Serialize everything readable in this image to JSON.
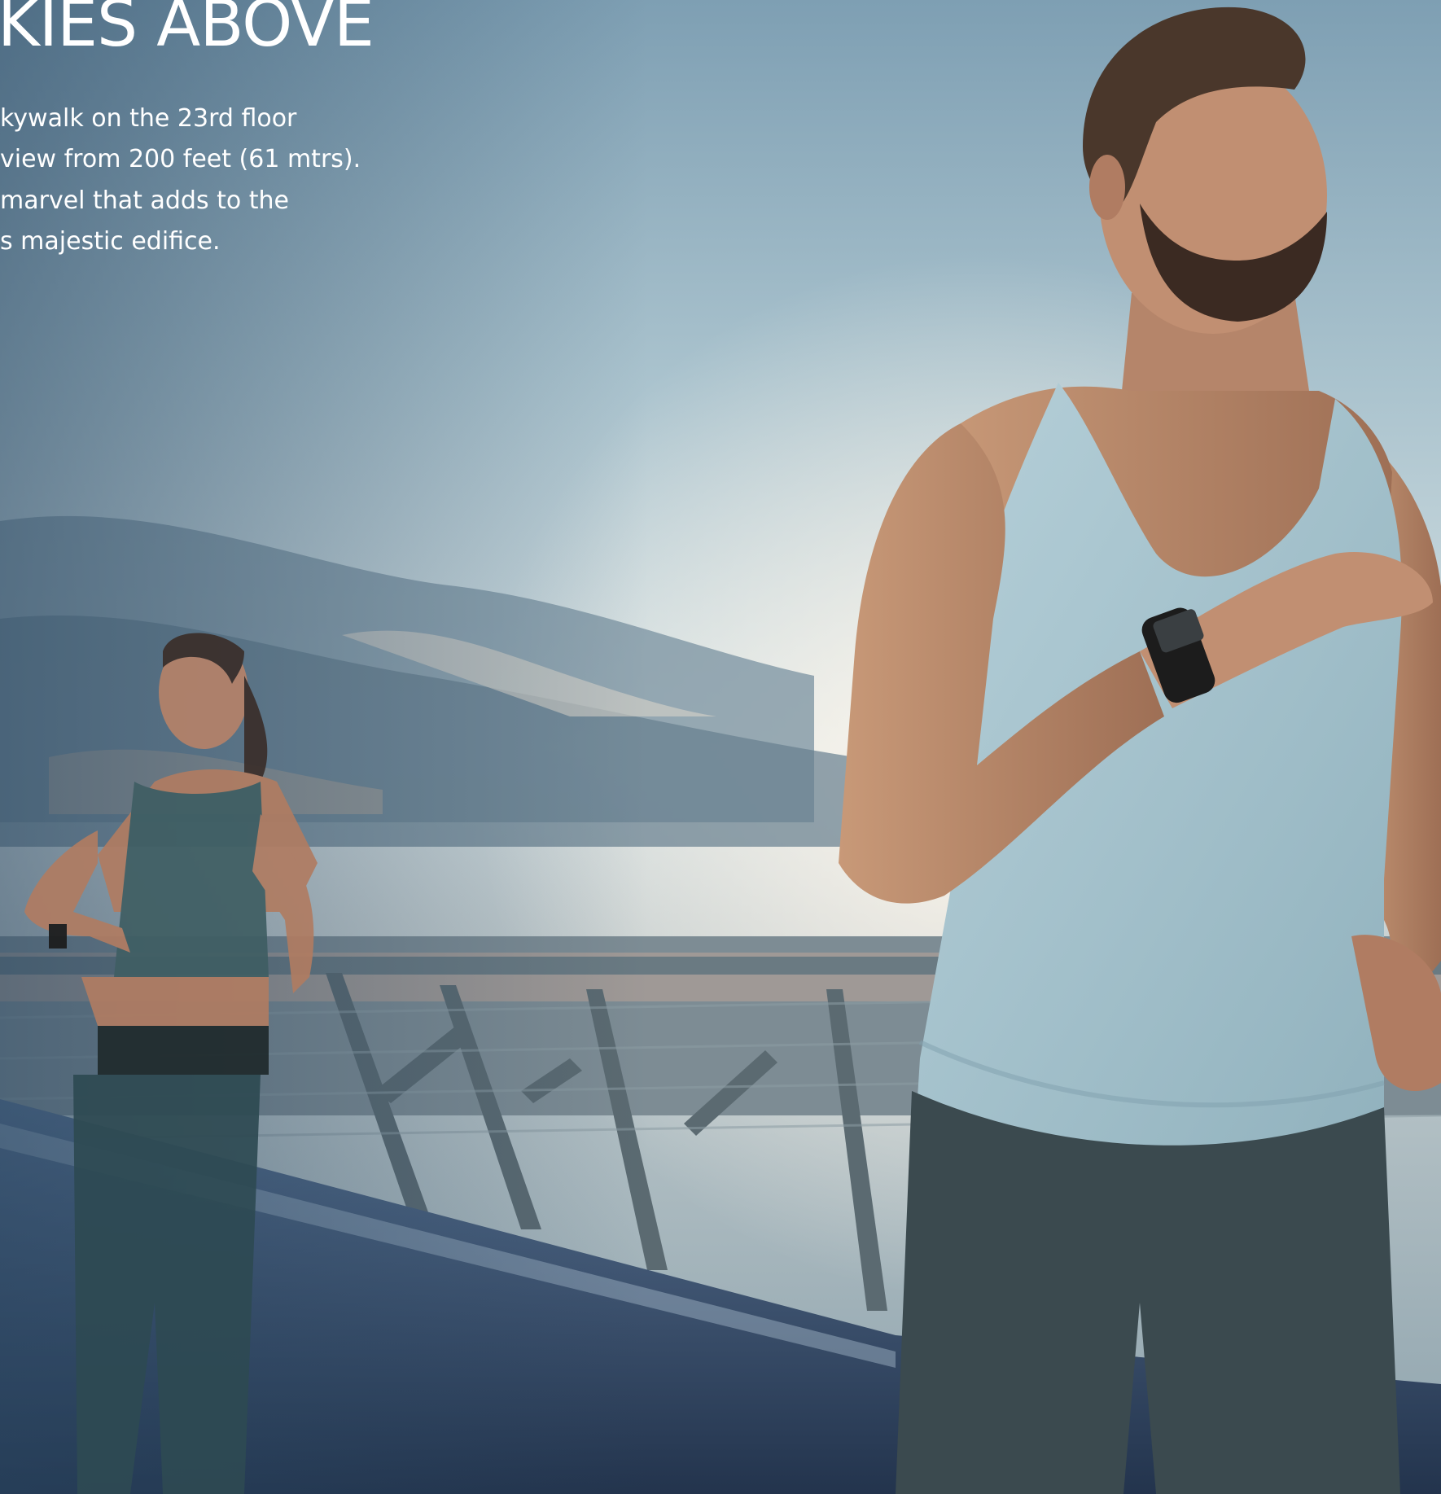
{
  "heading": "KIES ABOVE",
  "body_lines": [
    "kywalk on the 23rd floor",
    "view from 200 feet (61 mtrs).",
    " marvel that adds to the",
    "s majestic edifice."
  ],
  "photo": {
    "subject": "two people running on a rooftop skywalk at sunrise",
    "colors": {
      "sky_top": "#9fb7c4",
      "sky_bright": "#e8eef0",
      "cloud": "#6f8796",
      "skin": "#b98a6e",
      "tank_top": "#a6c2cc",
      "shorts": "#3b4a4f",
      "sports_top": "#3f5e63",
      "path": "#3c5578"
    }
  }
}
